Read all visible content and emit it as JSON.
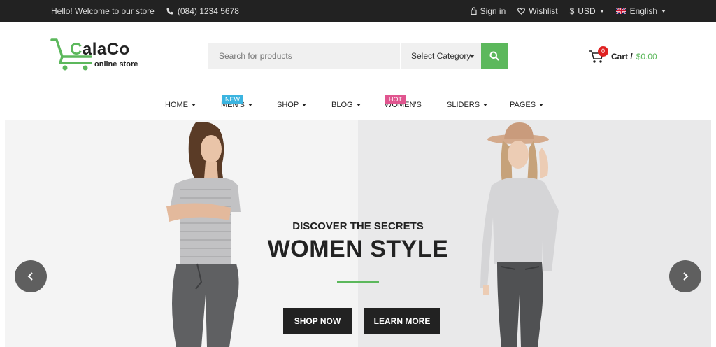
{
  "topbar": {
    "welcome": "Hello! Welcome to our store",
    "phone": "(084) 1234 5678",
    "sign_in": "Sign in",
    "wishlist": "Wishlist",
    "currency_symbol": "$",
    "currency": "USD",
    "language": "English"
  },
  "logo": {
    "brand_first": "C",
    "brand_rest": "alaCo",
    "tagline": "online store"
  },
  "search": {
    "placeholder": "Search for products",
    "category": "Select Category"
  },
  "cart": {
    "count": "0",
    "label": "Cart /",
    "amount": "$0.00"
  },
  "nav": {
    "home": "HOME",
    "mens": "MEN'S",
    "mens_flag": "NEW",
    "shop": "SHOP",
    "blog": "BLOG",
    "womens": "WOMEN'S",
    "womens_flag": "HOT",
    "sliders": "SLIDERS",
    "pages": "PAGES"
  },
  "hero": {
    "subtitle": "DISCOVER THE SECRETS",
    "title": "WOMEN STYLE",
    "shop_now": "SHOP NOW",
    "learn_more": "LEARN MORE"
  },
  "colors": {
    "accent": "#5cb85c",
    "topbar": "#222222",
    "new_flag": "#3bb4e0",
    "hot_flag": "#e0558f",
    "cart_badge": "#e02222"
  }
}
